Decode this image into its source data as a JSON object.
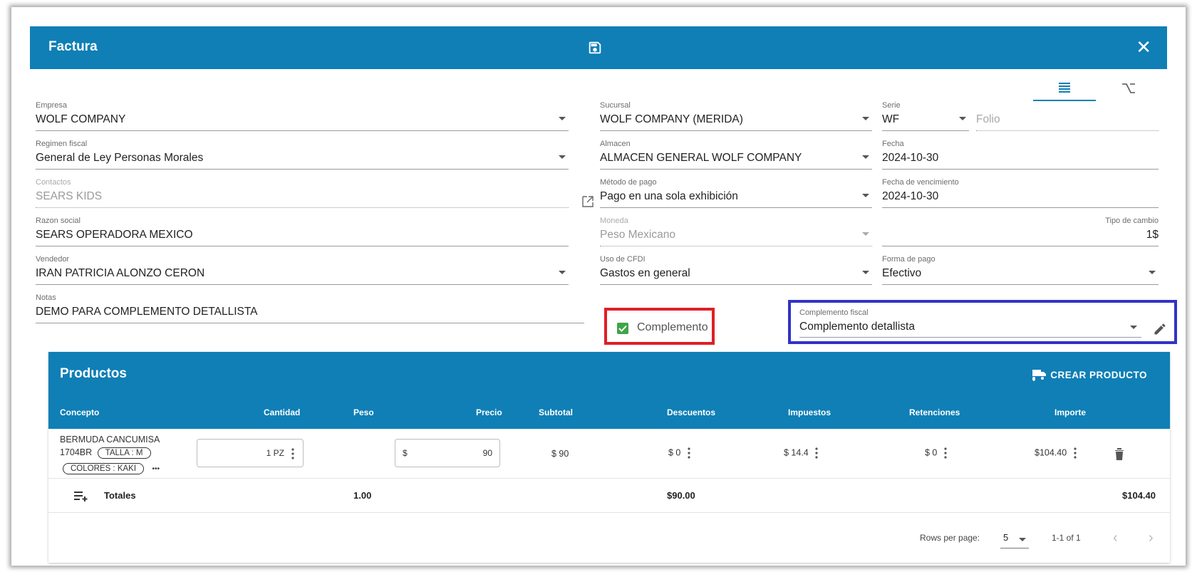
{
  "header": {
    "title": "Factura",
    "close": "✕"
  },
  "fields": {
    "empresa": {
      "label": "Empresa",
      "value": "WOLF COMPANY"
    },
    "sucursal": {
      "label": "Sucursal",
      "value": "WOLF COMPANY (MERIDA)"
    },
    "serie": {
      "label": "Serie",
      "value": "WF"
    },
    "folio": {
      "placeholder": "Folio"
    },
    "regimen": {
      "label": "Regimen fiscal",
      "value": "General de Ley Personas Morales"
    },
    "almacen": {
      "label": "Almacen",
      "value": "ALMACEN GENERAL WOLF COMPANY"
    },
    "fecha": {
      "label": "Fecha",
      "value": "2024-10-30"
    },
    "contactos": {
      "label": "Contactos",
      "value": "SEARS KIDS"
    },
    "metodo_pago": {
      "label": "Método de pago",
      "value": "Pago en una sola exhibición"
    },
    "fecha_venc": {
      "label": "Fecha de vencimiento",
      "value": "2024-10-30"
    },
    "razon_social": {
      "label": "Razon social",
      "value": "SEARS OPERADORA MEXICO"
    },
    "moneda": {
      "label": "Moneda",
      "value": "Peso Mexicano"
    },
    "tipo_cambio": {
      "label": "Tipo de cambio",
      "value": "1$"
    },
    "vendedor": {
      "label": "Vendedor",
      "value": "IRAN PATRICIA ALONZO CERON"
    },
    "uso_cfdi": {
      "label": "Uso de CFDI",
      "value": "Gastos en general"
    },
    "forma_pago": {
      "label": "Forma de pago",
      "value": "Efectivo"
    },
    "notas": {
      "label": "Notas",
      "value": "DEMO PARA COMPLEMENTO DETALLISTA"
    },
    "complemento_check": {
      "label": "Complemento",
      "checked": true
    },
    "complemento_fiscal": {
      "label": "Complemento fiscal",
      "value": "Complemento detallista"
    }
  },
  "products": {
    "title": "Productos",
    "create_label": "CREAR PRODUCTO",
    "columns": [
      "Concepto",
      "Cantidad",
      "Peso",
      "Precio",
      "Subtotal",
      "Descuentos",
      "Impuestos",
      "Retenciones",
      "Importe"
    ],
    "row": {
      "name": "BERMUDA CANCUMISA",
      "code": "1704BR",
      "chip1": "TALLA : M",
      "chip2": "COLORES : KAKI",
      "more": "•••",
      "cantidad": "1 PZ",
      "precio_prefix": "$",
      "precio": "90",
      "subtotal": "$ 90",
      "descuentos": "$ 0",
      "impuestos": "$ 14.4",
      "retenciones": "$ 0",
      "importe": "$104.40"
    },
    "totals": {
      "label": "Totales",
      "peso": "1.00",
      "descuentos": "$90.00",
      "importe": "$104.40"
    },
    "footer": {
      "rows_per_page_label": "Rows per page:",
      "rows_per_page": "5",
      "range": "1-1 of 1"
    }
  },
  "colors": {
    "primary": "#0f7fb6",
    "highlight_red": "#e01e26",
    "highlight_blue": "#3233c7",
    "check_green": "#3fa548"
  }
}
